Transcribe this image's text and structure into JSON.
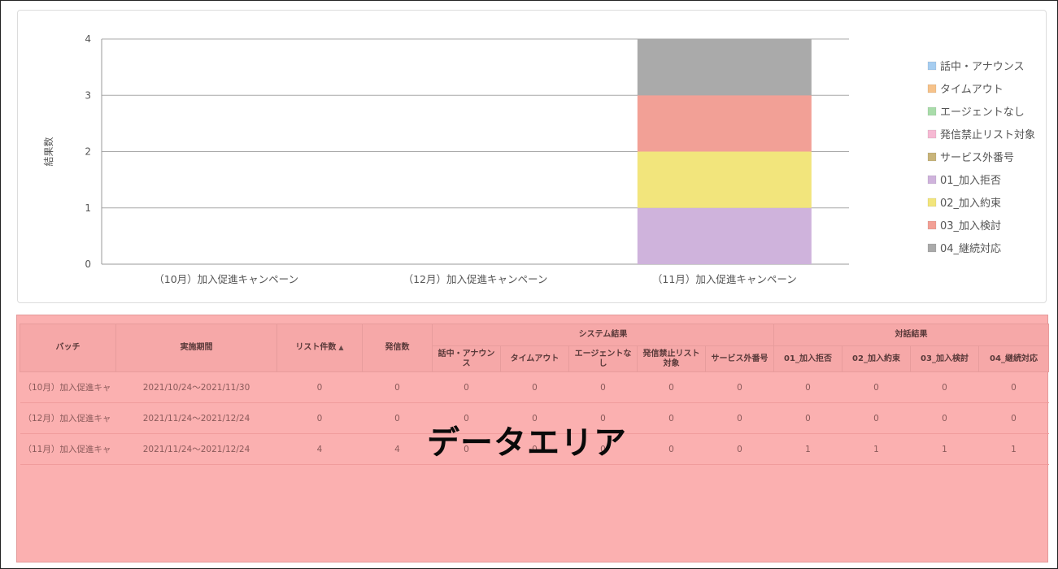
{
  "chart_data": {
    "type": "bar",
    "stacked": true,
    "categories": [
      "（10月）加入促進キャンペーン",
      "（12月）加入促進キャンペーン",
      "（11月）加入促進キャンペーン"
    ],
    "ylabel": "結果数",
    "ylim": [
      0,
      4
    ],
    "yticks": [
      0,
      1,
      2,
      3,
      4
    ],
    "grid": true,
    "legend_position": "right",
    "series": [
      {
        "name": "話中・アナウンス",
        "color": "#a6cdf0",
        "values": [
          0,
          0,
          0
        ]
      },
      {
        "name": "タイムアウト",
        "color": "#f6c28a",
        "values": [
          0,
          0,
          0
        ]
      },
      {
        "name": "エージェントなし",
        "color": "#a9dcaa",
        "values": [
          0,
          0,
          0
        ]
      },
      {
        "name": "発信禁止リスト対象",
        "color": "#f6b9d3",
        "values": [
          0,
          0,
          0
        ]
      },
      {
        "name": "サービス外番号",
        "color": "#c8b47a",
        "values": [
          0,
          0,
          0
        ]
      },
      {
        "name": "01_加入拒否",
        "color": "#cfb3dc",
        "values": [
          0,
          0,
          1
        ]
      },
      {
        "name": "02_加入約束",
        "color": "#f2e57c",
        "values": [
          0,
          0,
          1
        ]
      },
      {
        "name": "03_加入検討",
        "color": "#f2a096",
        "values": [
          0,
          0,
          1
        ]
      },
      {
        "name": "04_継続対応",
        "color": "#aaaaaa",
        "values": [
          0,
          0,
          1
        ]
      }
    ]
  },
  "table": {
    "headers": {
      "batch": "バッチ",
      "period": "実施期間",
      "list_count": "リスト件数",
      "call_count": "発信数",
      "system_group": "システム結果",
      "dialog_group": "対話結果",
      "system_cols": [
        "話中・アナウンス",
        "タイムアウト",
        "エージェントなし",
        "発信禁止リスト対象",
        "サービス外番号"
      ],
      "dialog_cols": [
        "01_加入拒否",
        "02_加入約束",
        "03_加入検討",
        "04_継続対応"
      ]
    },
    "sort_indicator": "▲",
    "rows": [
      {
        "batch": "（10月）加入促進キャ",
        "period": "2021/10/24～2021/11/30",
        "list_count": "0",
        "call_count": "0",
        "system": [
          "0",
          "0",
          "0",
          "0",
          "0"
        ],
        "dialog": [
          "0",
          "0",
          "0",
          "0"
        ]
      },
      {
        "batch": "（12月）加入促進キャ",
        "period": "2021/11/24～2021/12/24",
        "list_count": "0",
        "call_count": "0",
        "system": [
          "0",
          "0",
          "0",
          "0",
          "0"
        ],
        "dialog": [
          "0",
          "0",
          "0",
          "0"
        ]
      },
      {
        "batch": "（11月）加入促進キャ",
        "period": "2021/11/24～2021/12/24",
        "list_count": "4",
        "call_count": "4",
        "system": [
          "0",
          "0",
          "0",
          "0",
          "0"
        ],
        "dialog": [
          "1",
          "1",
          "1",
          "1"
        ]
      }
    ]
  },
  "overlay_label": "データエリア"
}
